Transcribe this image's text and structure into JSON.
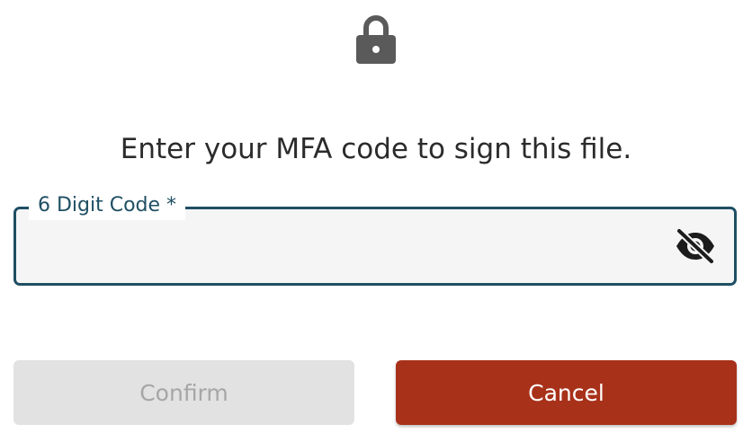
{
  "dialog": {
    "icon": "lock-icon",
    "prompt": "Enter your MFA code to sign this file.",
    "code_field": {
      "label": "6 Digit Code *",
      "value": "",
      "placeholder": "",
      "visibility_icon": "eye-off-icon"
    },
    "buttons": {
      "confirm_label": "Confirm",
      "cancel_label": "Cancel"
    }
  },
  "colors": {
    "accent": "#1f4f63",
    "cancel": "#a8311a",
    "confirm_disabled_bg": "#e2e2e2",
    "confirm_disabled_text": "#a6a6a6",
    "icon": "#5a5a5a"
  }
}
